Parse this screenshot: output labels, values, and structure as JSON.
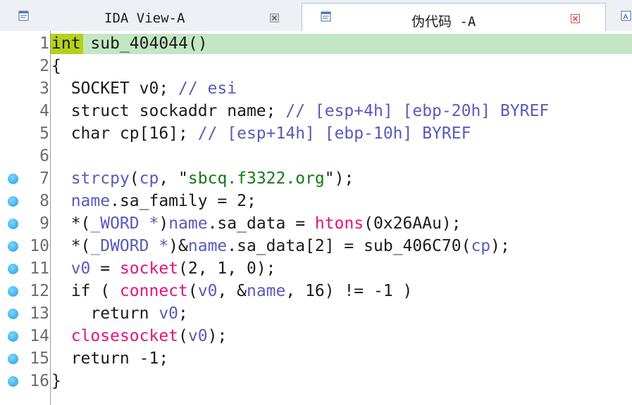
{
  "tabs": [
    {
      "label": "IDA View-A",
      "active": false
    },
    {
      "label": "伪代码 -A",
      "active": true
    },
    {
      "label": "A",
      "active": false
    }
  ],
  "colors": {
    "highlight_row": "#c4e6c4",
    "highlight_word": "#b4d21a",
    "variable": "#5a5aba",
    "function": "#e0147a",
    "string": "#117a11",
    "breakpoint": "#1d9ee6"
  },
  "icons": {
    "tab1": "ida-view-icon",
    "tab2": "pseudocode-icon",
    "tab3": "text-icon",
    "close": "close-icon",
    "breakpoint": "breakpoint-dot-icon"
  },
  "code": {
    "lines": [
      {
        "num": "1",
        "bp": false,
        "tokens": [
          [
            "kw",
            "int"
          ],
          [
            "tx",
            " sub_404044"
          ],
          [
            "tx",
            "()"
          ]
        ]
      },
      {
        "num": "2",
        "bp": false,
        "tokens": [
          [
            "tx",
            "{"
          ]
        ]
      },
      {
        "num": "3",
        "bp": false,
        "tokens": [
          [
            "tx",
            "  SOCKET v0; "
          ],
          [
            "cm",
            "// esi"
          ]
        ]
      },
      {
        "num": "4",
        "bp": false,
        "tokens": [
          [
            "tx",
            "  struct sockaddr name; "
          ],
          [
            "cm",
            "// [esp+4h] [ebp-20h] BYREF"
          ]
        ]
      },
      {
        "num": "5",
        "bp": false,
        "tokens": [
          [
            "tx",
            "  char cp[16]; "
          ],
          [
            "cm",
            "// [esp+14h] [ebp-10h] BYREF"
          ]
        ]
      },
      {
        "num": "6",
        "bp": false,
        "tokens": [
          [
            "tx",
            ""
          ]
        ]
      },
      {
        "num": "7",
        "bp": true,
        "tokens": [
          [
            "tx",
            "  "
          ],
          [
            "vr",
            "strcpy"
          ],
          [
            "tx",
            "("
          ],
          [
            "vr",
            "cp"
          ],
          [
            "tx",
            ", \""
          ],
          [
            "st",
            "sbcq.f3322.org"
          ],
          [
            "tx",
            "\");"
          ]
        ]
      },
      {
        "num": "8",
        "bp": true,
        "tokens": [
          [
            "tx",
            "  "
          ],
          [
            "vr",
            "name"
          ],
          [
            "tx",
            ".sa_family = 2;"
          ]
        ]
      },
      {
        "num": "9",
        "bp": true,
        "tokens": [
          [
            "tx",
            "  *("
          ],
          [
            "vr",
            "_WORD *"
          ],
          [
            "tx",
            ")"
          ],
          [
            "vr",
            "name"
          ],
          [
            "tx",
            ".sa_data = "
          ],
          [
            "fn",
            "htons"
          ],
          [
            "tx",
            "(0x26AAu);"
          ]
        ]
      },
      {
        "num": "10",
        "bp": true,
        "tokens": [
          [
            "tx",
            "  *("
          ],
          [
            "vr",
            "_DWORD *"
          ],
          [
            "tx",
            ")&"
          ],
          [
            "vr",
            "name"
          ],
          [
            "tx",
            ".sa_data[2] = sub_406C70("
          ],
          [
            "vr",
            "cp"
          ],
          [
            "tx",
            ");"
          ]
        ]
      },
      {
        "num": "11",
        "bp": true,
        "tokens": [
          [
            "tx",
            "  "
          ],
          [
            "vr",
            "v0"
          ],
          [
            "tx",
            " = "
          ],
          [
            "fn",
            "socket"
          ],
          [
            "tx",
            "(2, 1, 0);"
          ]
        ]
      },
      {
        "num": "12",
        "bp": true,
        "tokens": [
          [
            "tx",
            "  if ( "
          ],
          [
            "fn",
            "connect"
          ],
          [
            "tx",
            "("
          ],
          [
            "vr",
            "v0"
          ],
          [
            "tx",
            ", &"
          ],
          [
            "vr",
            "name"
          ],
          [
            "tx",
            ", 16) != -1 )"
          ]
        ]
      },
      {
        "num": "13",
        "bp": true,
        "tokens": [
          [
            "tx",
            "    return "
          ],
          [
            "vr",
            "v0"
          ],
          [
            "tx",
            ";"
          ]
        ]
      },
      {
        "num": "14",
        "bp": true,
        "tokens": [
          [
            "tx",
            "  "
          ],
          [
            "fn",
            "closesocket"
          ],
          [
            "tx",
            "("
          ],
          [
            "vr",
            "v0"
          ],
          [
            "tx",
            ");"
          ]
        ]
      },
      {
        "num": "15",
        "bp": true,
        "tokens": [
          [
            "tx",
            "  return -1;"
          ]
        ]
      },
      {
        "num": "16",
        "bp": true,
        "tokens": [
          [
            "tx",
            "}"
          ]
        ]
      }
    ]
  }
}
